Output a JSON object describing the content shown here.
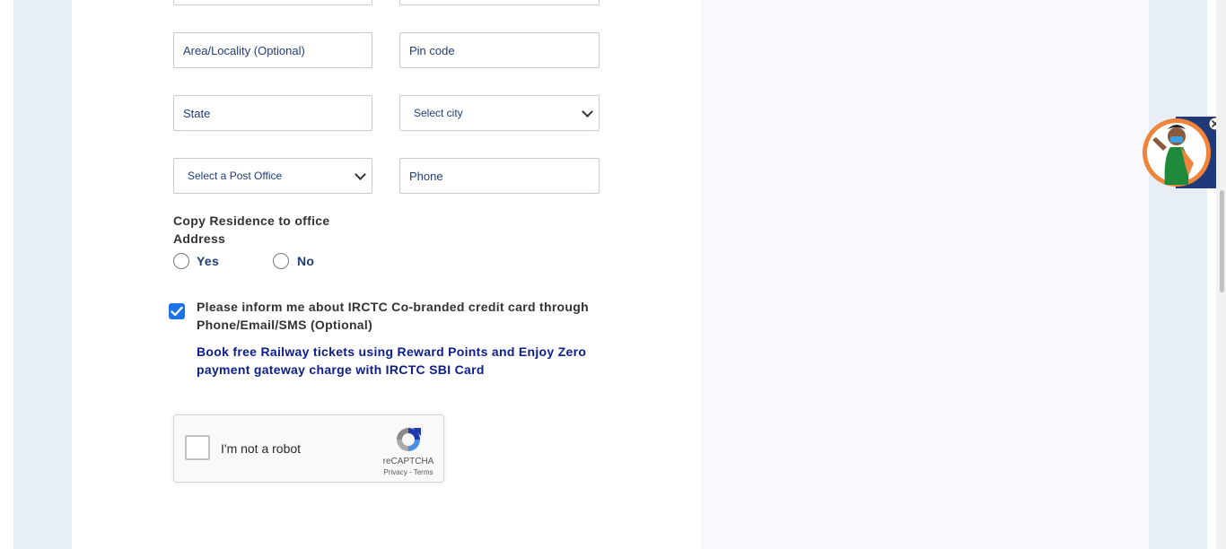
{
  "form": {
    "area_placeholder": "Area/Locality (Optional)",
    "pincode_placeholder": "Pin code",
    "state_placeholder": "State",
    "city_select": "Select city",
    "post_office_select": "Select a Post Office",
    "phone_placeholder": "Phone"
  },
  "copy_address": {
    "question": "Copy Residence to office Address",
    "yes_label": "Yes",
    "no_label": "No"
  },
  "consent": {
    "checked": true,
    "text": "Please inform me about IRCTC Co-branded credit card through Phone/Email/SMS (Optional)",
    "promo": "Book free Railway tickets using Reward Points and Enjoy Zero payment gateway charge with IRCTC SBI Card"
  },
  "recaptcha": {
    "label": "I'm not a robot",
    "brand": "reCAPTCHA",
    "links": "Privacy - Terms"
  },
  "colors": {
    "accent_blue": "#213d77",
    "promo_blue": "#0b1d8f",
    "checkbox_blue": "#1a73e8",
    "gutter": "#e8eef6"
  },
  "icons": [
    "chevron-down-icon",
    "checkmark-icon",
    "recaptcha-logo-icon",
    "close-icon",
    "mascot-avatar"
  ]
}
